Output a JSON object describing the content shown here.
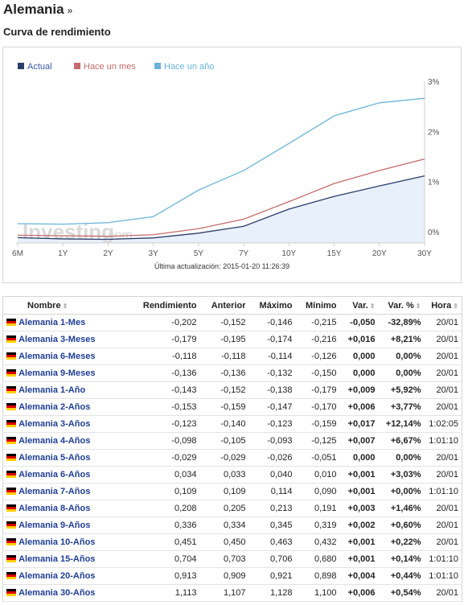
{
  "header": {
    "title": "Alemania",
    "title_arrow": "»",
    "subtitle": "Curva de rendimiento"
  },
  "chart": {
    "watermark": "Investing",
    "watermark_suffix": ".com",
    "update_text": "Última actualización: 2015-01-20 11:26:39"
  },
  "chart_data": {
    "type": "line",
    "categories": [
      "6M",
      "1Y",
      "2Y",
      "3Y",
      "5Y",
      "7Y",
      "10Y",
      "15Y",
      "20Y",
      "30Y"
    ],
    "y_ticks": [
      "3%",
      "2%",
      "1%",
      "0%"
    ],
    "ylim": [
      -0.2,
      3
    ],
    "y_axis_position": "right",
    "legend_position": "top-left",
    "grid": false,
    "series": [
      {
        "name": "Actual",
        "color": "#2b3e6a",
        "area": true,
        "values": [
          -0.118,
          -0.143,
          -0.153,
          -0.123,
          -0.029,
          0.109,
          0.451,
          0.704,
          0.913,
          1.113
        ]
      },
      {
        "name": "Hace un mes",
        "color": "#c46b6b",
        "values": [
          -0.07,
          -0.08,
          -0.09,
          -0.06,
          0.06,
          0.25,
          0.6,
          0.96,
          1.22,
          1.45
        ]
      },
      {
        "name": "Hace un año",
        "color": "#6ab4d8",
        "values": [
          0.16,
          0.15,
          0.18,
          0.3,
          0.83,
          1.22,
          1.76,
          2.31,
          2.57,
          2.66
        ]
      }
    ]
  },
  "table": {
    "headers": {
      "name": "Nombre",
      "yield": "Rendimiento",
      "prev": "Anterior",
      "high": "Máximo",
      "low": "Mínimo",
      "chg": "Var.",
      "chg_pct": "Var. %",
      "time": "Hora"
    },
    "rows": [
      {
        "name": "Alemania 1-Mes",
        "yield": "-0,202",
        "prev": "-0,152",
        "high": "-0,146",
        "low": "-0,215",
        "chg": "-0,050",
        "chg_pct": "-32,89%",
        "time": "20/01",
        "trend": "neg"
      },
      {
        "name": "Alemania 3-Meses",
        "yield": "-0,179",
        "prev": "-0,195",
        "high": "-0,174",
        "low": "-0,216",
        "chg": "+0,016",
        "chg_pct": "+8,21%",
        "time": "20/01",
        "trend": "pos"
      },
      {
        "name": "Alemania 6-Meses",
        "yield": "-0,118",
        "prev": "-0,118",
        "high": "-0,114",
        "low": "-0,126",
        "chg": "0,000",
        "chg_pct": "0,00%",
        "time": "20/01",
        "trend": "zero"
      },
      {
        "name": "Alemania 9-Meses",
        "yield": "-0,136",
        "prev": "-0,136",
        "high": "-0,132",
        "low": "-0,150",
        "chg": "0,000",
        "chg_pct": "0,00%",
        "time": "20/01",
        "trend": "zero"
      },
      {
        "name": "Alemania 1-Año",
        "yield": "-0,143",
        "prev": "-0,152",
        "high": "-0,138",
        "low": "-0,179",
        "chg": "+0,009",
        "chg_pct": "+5,92%",
        "time": "20/01",
        "trend": "pos"
      },
      {
        "name": "Alemania 2-Años",
        "yield": "-0,153",
        "prev": "-0,159",
        "high": "-0,147",
        "low": "-0,170",
        "chg": "+0,006",
        "chg_pct": "+3,77%",
        "time": "20/01",
        "trend": "pos"
      },
      {
        "name": "Alemania 3-Años",
        "yield": "-0,123",
        "prev": "-0,140",
        "high": "-0,123",
        "low": "-0,159",
        "chg": "+0,017",
        "chg_pct": "+12,14%",
        "time": "1:02:05",
        "trend": "pos"
      },
      {
        "name": "Alemania 4-Años",
        "yield": "-0,098",
        "prev": "-0,105",
        "high": "-0,093",
        "low": "-0,125",
        "chg": "+0,007",
        "chg_pct": "+6,67%",
        "time": "1:01:10",
        "trend": "pos"
      },
      {
        "name": "Alemania 5-Años",
        "yield": "-0,029",
        "prev": "-0,029",
        "high": "-0,026",
        "low": "-0,051",
        "chg": "0,000",
        "chg_pct": "0,00%",
        "time": "20/01",
        "trend": "zero"
      },
      {
        "name": "Alemania 6-Años",
        "yield": "0,034",
        "prev": "0,033",
        "high": "0,040",
        "low": "0,010",
        "chg": "+0,001",
        "chg_pct": "+3,03%",
        "time": "20/01",
        "trend": "pos"
      },
      {
        "name": "Alemania 7-Años",
        "yield": "0,109",
        "prev": "0,109",
        "high": "0,114",
        "low": "0,090",
        "chg": "+0,001",
        "chg_pct": "+0,00%",
        "time": "1:01:10",
        "trend": "pos"
      },
      {
        "name": "Alemania 8-Años",
        "yield": "0,208",
        "prev": "0,205",
        "high": "0,213",
        "low": "0,191",
        "chg": "+0,003",
        "chg_pct": "+1,46%",
        "time": "20/01",
        "trend": "pos"
      },
      {
        "name": "Alemania 9-Años",
        "yield": "0,336",
        "prev": "0,334",
        "high": "0,345",
        "low": "0,319",
        "chg": "+0,002",
        "chg_pct": "+0,60%",
        "time": "20/01",
        "trend": "pos"
      },
      {
        "name": "Alemania 10-Años",
        "yield": "0,451",
        "prev": "0,450",
        "high": "0,463",
        "low": "0,432",
        "chg": "+0,001",
        "chg_pct": "+0,22%",
        "time": "20/01",
        "trend": "pos"
      },
      {
        "name": "Alemania 15-Años",
        "yield": "0,704",
        "prev": "0,703",
        "high": "0,706",
        "low": "0,680",
        "chg": "+0,001",
        "chg_pct": "+0,14%",
        "time": "1:01:10",
        "trend": "pos"
      },
      {
        "name": "Alemania 20-Años",
        "yield": "0,913",
        "prev": "0,909",
        "high": "0,921",
        "low": "0,898",
        "chg": "+0,004",
        "chg_pct": "+0,44%",
        "time": "1:01:10",
        "trend": "pos"
      },
      {
        "name": "Alemania 30-Años",
        "yield": "1,113",
        "prev": "1,107",
        "high": "1,128",
        "low": "1,100",
        "chg": "+0,006",
        "chg_pct": "+0,54%",
        "time": "20/01",
        "trend": "pos"
      }
    ]
  }
}
